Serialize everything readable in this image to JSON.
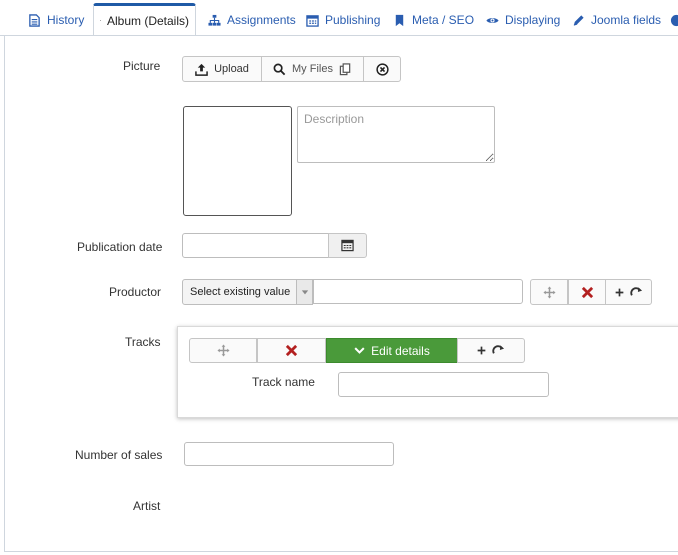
{
  "tabs": [
    {
      "label": "History",
      "icon": "document-icon"
    },
    {
      "label": "Album (Details)",
      "icon": "checklist-icon",
      "active": true
    },
    {
      "label": "Assignments",
      "icon": "sitemap-icon"
    },
    {
      "label": "Publishing",
      "icon": "calendar-icon"
    },
    {
      "label": "Meta / SEO",
      "icon": "bookmark-icon"
    },
    {
      "label": "Displaying",
      "icon": "eye-icon"
    },
    {
      "label": "Joomla fields",
      "icon": "pencil-icon"
    }
  ],
  "picture": {
    "label": "Picture",
    "upload_label": "Upload",
    "myfiles_label": "My Files",
    "description_placeholder": "Description"
  },
  "publication_date": {
    "label": "Publication date",
    "value": ""
  },
  "productor": {
    "label": "Productor",
    "select_value": "Select existing value",
    "input_value": ""
  },
  "tracks": {
    "label": "Tracks",
    "edit_details_label": "Edit details",
    "track_name_label": "Track name",
    "track_name_value": ""
  },
  "number_of_sales": {
    "label": "Number of sales",
    "value": ""
  },
  "artist": {
    "label": "Artist"
  },
  "colors": {
    "accent": "#2a5db0",
    "active_tab_top": "#1f5aa6",
    "green": "#4a9a3a",
    "red": "#b32020"
  }
}
